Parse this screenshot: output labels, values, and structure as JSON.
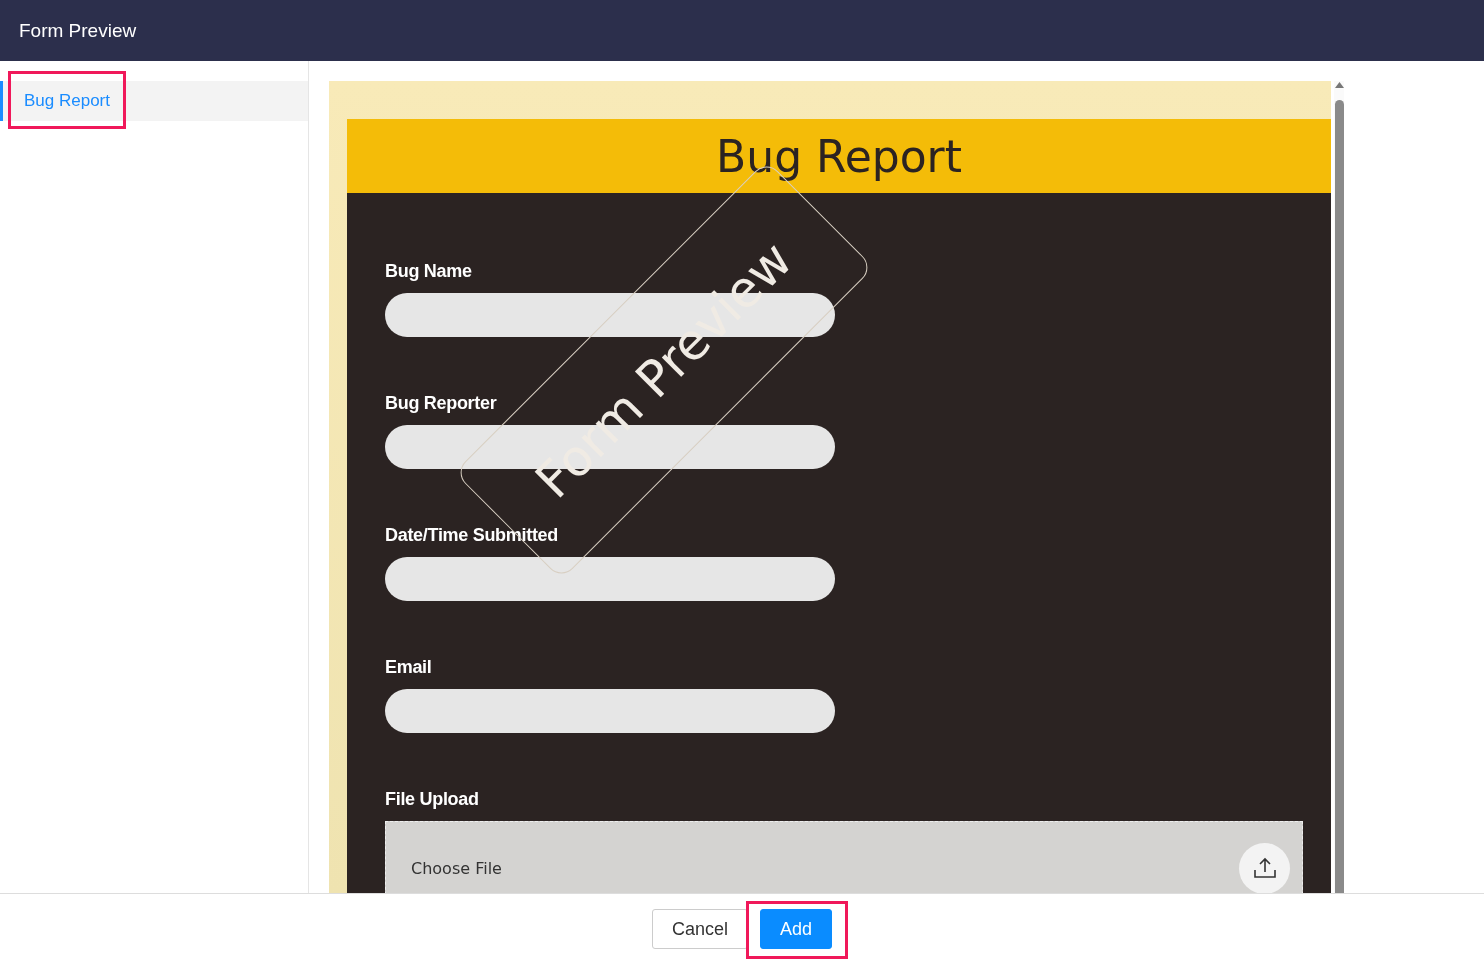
{
  "window": {
    "title": "Form Preview"
  },
  "sidebar": {
    "items": [
      {
        "label": "Bug Report",
        "selected": true,
        "highlighted": true
      }
    ]
  },
  "form": {
    "title": "Bug Report",
    "watermark": "Form Preview",
    "fields": [
      {
        "kind": "text",
        "label": "Bug Name"
      },
      {
        "kind": "text",
        "label": "Bug Reporter"
      },
      {
        "kind": "text",
        "label": "Date/Time Submitted"
      },
      {
        "kind": "text",
        "label": "Email"
      },
      {
        "kind": "file",
        "label": "File Upload",
        "placeholder": "Choose File"
      }
    ]
  },
  "buttons": [
    {
      "label": "Cancel",
      "kind": "secondary",
      "highlighted": false
    },
    {
      "label": "Add",
      "kind": "primary",
      "highlighted": true
    }
  ]
}
